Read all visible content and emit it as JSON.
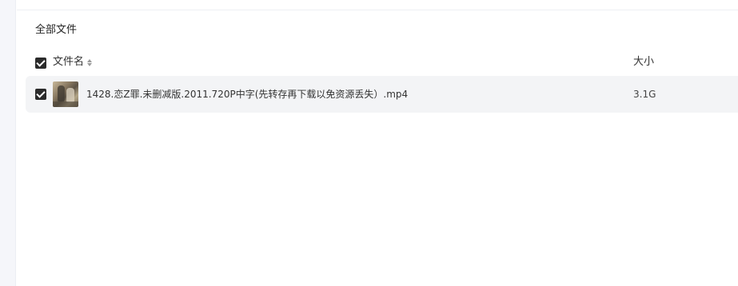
{
  "breadcrumb": {
    "label": "全部文件"
  },
  "table": {
    "header": {
      "name_label": "文件名",
      "size_label": "大小",
      "select_all_checked": true,
      "sort_icon": "sort-icon"
    },
    "rows": [
      {
        "checked": true,
        "thumbnail": "video-thumbnail",
        "name": "1428.恋Z罪.未删减版.2011.720P中字(先转存再下载以免资源丢失）.mp4",
        "size": "3.1G"
      }
    ]
  },
  "colors": {
    "checkbox": "#2b2b2b",
    "row_highlight": "#f3f4f6",
    "left_rail": "#f5f6fa"
  }
}
